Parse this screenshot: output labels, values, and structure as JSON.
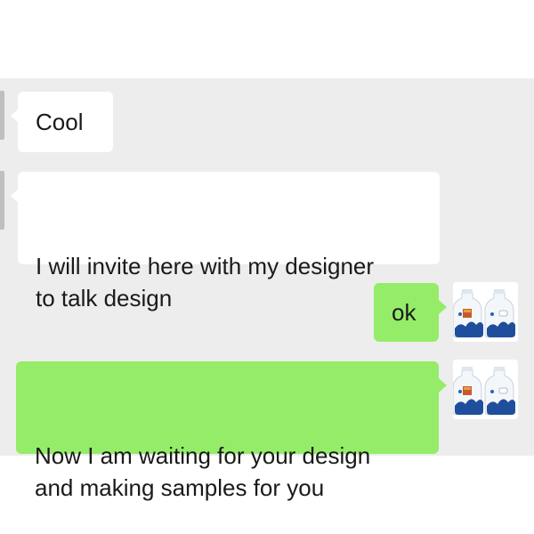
{
  "messages": [
    {
      "side": "incoming",
      "text": "Cool"
    },
    {
      "side": "incoming",
      "text": "I will invite here with my designer\nto talk design"
    },
    {
      "side": "outgoing",
      "text": "ok"
    },
    {
      "side": "outgoing",
      "text": "Now I am waiting for your design\nand making samples for you"
    }
  ],
  "icons": {
    "avatar": "blue-white-bottles-avatar-icon",
    "bubble_tail": "speech-bubble-tail"
  },
  "colors": {
    "chat_background": "#ededed",
    "incoming_bubble": "#ffffff",
    "outgoing_bubble": "#95ec69",
    "text": "#1a1a1a"
  }
}
